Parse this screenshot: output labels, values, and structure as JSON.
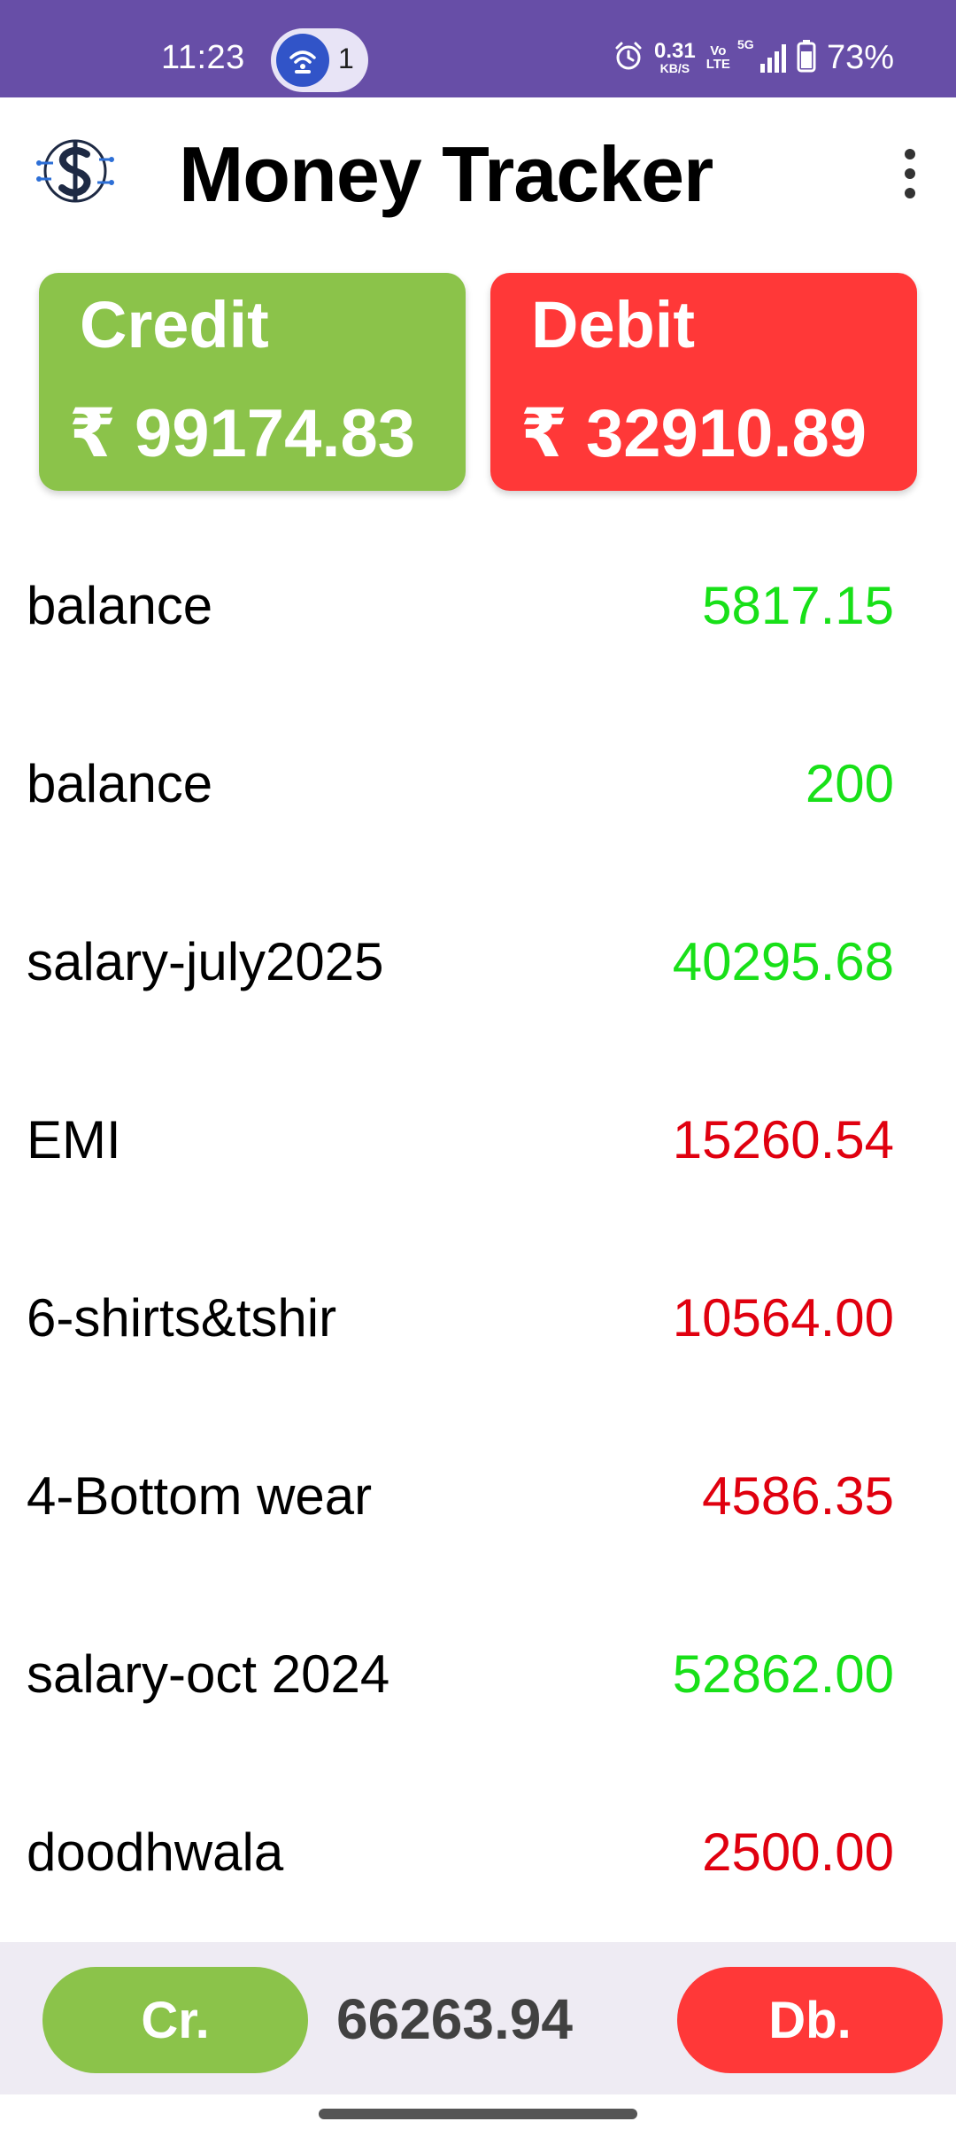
{
  "status_bar": {
    "time": "11:23",
    "hotspot_count": "1",
    "net_speed_value": "0.31",
    "net_speed_unit": "KB/S",
    "volte_top": "Vo",
    "volte_bottom": "LTE",
    "network_type": "5G",
    "battery": "73%"
  },
  "header": {
    "title": "Money Tracker"
  },
  "summary": {
    "credit_label": "Credit",
    "credit_amount": "₹ 99174.83",
    "debit_label": "Debit",
    "debit_amount": "₹ 32910.89"
  },
  "transactions": [
    {
      "name": "balance",
      "amount": "5817.15",
      "type": "credit"
    },
    {
      "name": "balance",
      "amount": "200",
      "type": "credit"
    },
    {
      "name": "salary-july2025",
      "amount": "40295.68",
      "type": "credit"
    },
    {
      "name": "EMI",
      "amount": "15260.54",
      "type": "debit"
    },
    {
      "name": "6-shirts&tshir",
      "amount": "10564.00",
      "type": "debit"
    },
    {
      "name": "4-Bottom wear",
      "amount": "4586.35",
      "type": "debit"
    },
    {
      "name": "salary-oct 2024",
      "amount": "52862.00",
      "type": "credit"
    },
    {
      "name": "doodhwala",
      "amount": "2500.00",
      "type": "debit"
    }
  ],
  "bottom_bar": {
    "credit_button": "Cr.",
    "net_total": "66263.94",
    "debit_button": "Db."
  },
  "colors": {
    "status_bar": "#674ea7",
    "credit_green": "#8bc34a",
    "debit_red": "#ff3838",
    "credit_text": "#18e018",
    "debit_text": "#e0000f"
  }
}
